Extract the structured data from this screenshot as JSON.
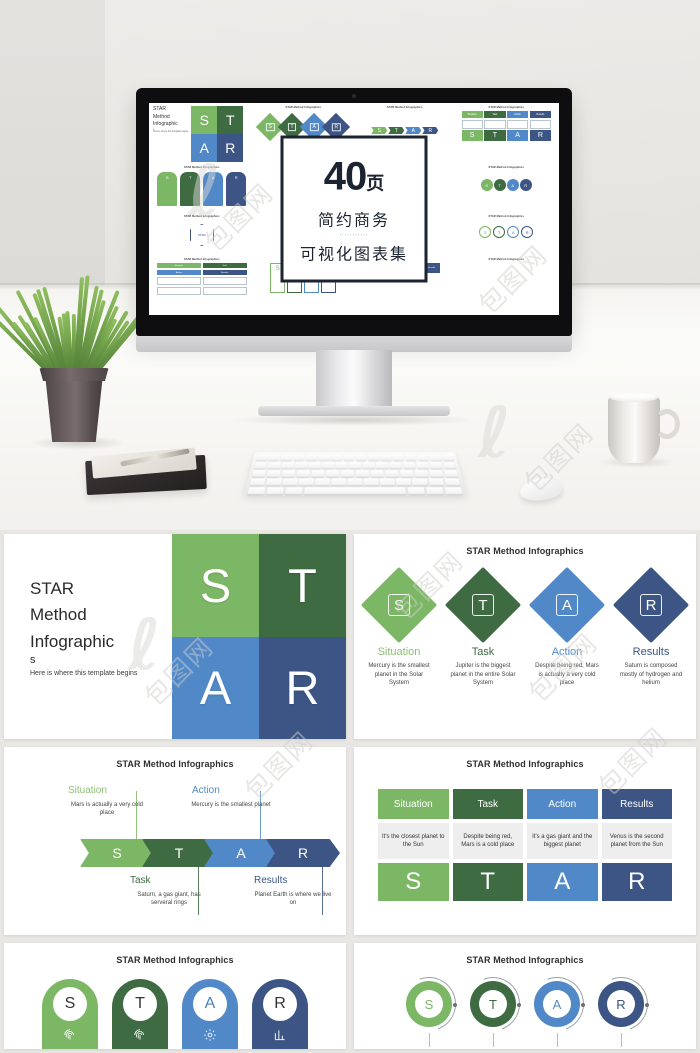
{
  "hero": {
    "poster": {
      "page_count": "40",
      "page_unit": "页",
      "line2": "简约商务",
      "line3": "可视化图表集",
      "dots": "···········"
    },
    "screen_deck": {
      "title": "STAR Method Infographic",
      "sub": "Here is where this template begins",
      "slide_title": "STAR Method Infographics",
      "letters": [
        "S",
        "T",
        "A",
        "R"
      ],
      "labels": [
        "Situation",
        "Task",
        "Action",
        "Results"
      ],
      "center_word": "STAR"
    },
    "watermark": {
      "hook": "ℓ",
      "cn": "包图网"
    },
    "objects": {
      "monitor": "desktop-monitor",
      "keyboard": "wireless-keyboard",
      "mouse": "wireless-mouse",
      "mug": "coffee-mug",
      "plant": "potted-grass-plant",
      "notebook": "notebook-and-pen"
    }
  },
  "colors": {
    "green_light": "#7CB765",
    "green_dark": "#3F6B43",
    "blue_light": "#5189C8",
    "blue_dark": "#3C5584",
    "body_gray": "#eeeeee"
  },
  "panels": [
    {
      "id": "title-slide",
      "heading_lines": [
        "STAR",
        "Method",
        "Infographic",
        "s"
      ],
      "sub": "Here is where this template begins",
      "tiles": [
        {
          "letter": "S",
          "color": "#7CB765"
        },
        {
          "letter": "T",
          "color": "#3F6B43"
        },
        {
          "letter": "A",
          "color": "#5189C8"
        },
        {
          "letter": "R",
          "color": "#3C5584"
        }
      ]
    },
    {
      "id": "diamonds",
      "title": "STAR Method Infographics",
      "items": [
        {
          "letter": "S",
          "label": "Situation",
          "color": "#7CB765",
          "label_color": "#8CBF73",
          "text": "Mercury is the smallest planet in the Solar System"
        },
        {
          "letter": "T",
          "label": "Task",
          "color": "#3F6B43",
          "label_color": "#3F6B43",
          "text": "Jupiter is the biggest planet in the entire Solar System"
        },
        {
          "letter": "A",
          "label": "Action",
          "color": "#5189C8",
          "label_color": "#5189C8",
          "text": "Despite being red, Mars is actually a very cold place"
        },
        {
          "letter": "R",
          "label": "Results",
          "color": "#3C5584",
          "label_color": "#3C5584",
          "text": "Saturn is composed mostly of hydrogen and helium"
        }
      ]
    },
    {
      "id": "chevrons",
      "title": "STAR Method Infographics",
      "items": [
        {
          "letter": "S",
          "label": "Situation",
          "color": "#7CB765",
          "label_color": "#8CBF73",
          "text": "Mars is actually a very cold place",
          "side": "top"
        },
        {
          "letter": "T",
          "label": "Task",
          "color": "#3F6B43",
          "label_color": "#3F6B43",
          "text": "Saturn, a gas giant, has serveral rings",
          "side": "bottom"
        },
        {
          "letter": "A",
          "label": "Action",
          "color": "#5189C8",
          "label_color": "#5189C8",
          "text": "Mercury is the smallest planet",
          "side": "top"
        },
        {
          "letter": "R",
          "label": "Results",
          "color": "#3C5584",
          "label_color": "#3C5584",
          "text": "Planet Earth is where we live on",
          "side": "bottom"
        }
      ]
    },
    {
      "id": "boxes",
      "title": "STAR Method Infographics",
      "items": [
        {
          "letter": "S",
          "label": "Situation",
          "color": "#7CB765",
          "text": "It's the closest planet to the Sun"
        },
        {
          "letter": "T",
          "label": "Task",
          "color": "#3F6B43",
          "text": "Despite being red, Mars is a cold place"
        },
        {
          "letter": "A",
          "label": "Action",
          "color": "#5189C8",
          "text": "It's a gas giant and the biggest planet"
        },
        {
          "letter": "R",
          "label": "Results",
          "color": "#3C5584",
          "text": "Venus is the second planet from the Sun"
        }
      ]
    },
    {
      "id": "pills",
      "title": "STAR Method Infographics",
      "items": [
        {
          "letter": "S",
          "color": "#7CB765",
          "icon": "fingerprint-icon"
        },
        {
          "letter": "T",
          "color": "#3F6B43",
          "icon": "fingerprint-icon"
        },
        {
          "letter": "A",
          "color": "#5189C8",
          "icon": "gear-icon"
        },
        {
          "letter": "R",
          "color": "#3C5584",
          "icon": "bar-chart-icon"
        }
      ]
    },
    {
      "id": "rings",
      "title": "STAR Method Infographics",
      "items": [
        {
          "letter": "S",
          "color": "#7CB765"
        },
        {
          "letter": "T",
          "color": "#3F6B43"
        },
        {
          "letter": "A",
          "color": "#5189C8"
        },
        {
          "letter": "R",
          "color": "#3C5584"
        }
      ]
    }
  ]
}
